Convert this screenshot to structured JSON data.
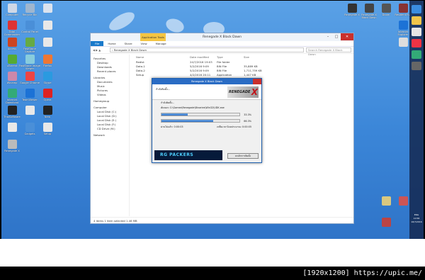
{
  "explorer": {
    "title": "Renegade X Black Dawn",
    "context_tab": "Application Tools",
    "ribbon_tabs": [
      "File",
      "Home",
      "Share",
      "View",
      "Manage"
    ],
    "path": "› Renegade X Black Dawn",
    "search_placeholder": "Search Renegade X Black Dawn",
    "nav": {
      "favorites": "Favorites",
      "fav_items": [
        "Desktop",
        "Downloads",
        "Recent places"
      ],
      "libraries": "Libraries",
      "lib_items": [
        "Documents",
        "Music",
        "Pictures",
        "Videos"
      ],
      "homegroup": "Homegroup",
      "computer": "Computer",
      "comp_items": [
        "Local Disk (C:)",
        "Local Disk (D:)",
        "Local Disk (E:)",
        "Local Disk (F:)",
        "CD Drive (M:)"
      ],
      "network": "Network"
    },
    "columns": [
      "Name",
      "Date modified",
      "Type",
      "Size"
    ],
    "files": [
      {
        "name": "Redist",
        "date": "24/7/2016 19:03",
        "type": "File folder",
        "size": ""
      },
      {
        "name": "Data-1",
        "date": "5/2/2016 9:09",
        "type": "BIN File",
        "size": "35,889 KB"
      },
      {
        "name": "Data-2",
        "date": "5/2/2016 9:09",
        "type": "BIN File",
        "size": "1,711,759 KB"
      },
      {
        "name": "Setup",
        "date": "4/2/2016 20:11",
        "type": "Application",
        "size": "1,447 KB"
      }
    ],
    "status": "4 items    1 item selected 1.46 MB"
  },
  "installer": {
    "title": "Renegade X Black Dawn",
    "header_label": "กำลังติดตั้ง...",
    "logo_text": "RENEGADE",
    "step1": "กำลังติดตั้ง...",
    "file_line": "คัดลอก: C:\\Games\\Renegade\\Binaries\\Win32\\UDK.exe",
    "progress1": {
      "value": 0.333,
      "label": "33.3%"
    },
    "progress2": {
      "value": 0.663,
      "label": "66.3%"
    },
    "elapsed": "ผ่านไปแล้ว: 0:00:03",
    "remaining": "เหลือเวลาโดยประมาณ: 0:00:05",
    "banner": "RG PACKERS",
    "cancel_label": "ยกเลิกการติดตั้ง"
  },
  "desktop_icons_left": [
    {
      "label": "Computer",
      "color": "#cfd8e6"
    },
    {
      "label": "Recycle Bin",
      "color": "#9fb6cf"
    },
    {
      "label": "",
      "color": "#dbe3ee"
    },
    {
      "label": "Total Commander",
      "color": "#d33"
    },
    {
      "label": "Control Panel",
      "color": "#4a8fd8"
    },
    {
      "label": "",
      "color": "#e8e8e8"
    },
    {
      "label": "Access",
      "color": "#c42"
    },
    {
      "label": "FastStone Capture",
      "color": "#6a4"
    },
    {
      "label": "",
      "color": "#e8e8e8"
    },
    {
      "label": "uTorrent",
      "color": "#5a3"
    },
    {
      "label": "FastStone Image Viewer",
      "color": "#8cd"
    },
    {
      "label": "Firefox",
      "color": "#e73"
    },
    {
      "label": "Winamp",
      "color": "#c8a"
    },
    {
      "label": "Google Chrome",
      "color": "#e44"
    },
    {
      "label": "Skype",
      "color": "#2a9ae0"
    },
    {
      "label": "Internet Download Manager",
      "color": "#3a7"
    },
    {
      "label": "TeamViewer",
      "color": "#1c72d6"
    },
    {
      "label": "Opera",
      "color": "#d22"
    },
    {
      "label": "ThaiSoftware",
      "color": "#222"
    },
    {
      "label": "",
      "color": "#e8e8e8"
    },
    {
      "label": "Nero",
      "color": "#222"
    },
    {
      "label": "",
      "color": "#e8e8e8"
    },
    {
      "label": "Gadgets",
      "color": "#4a8fd8"
    },
    {
      "label": "Setup",
      "color": "#e8e8e8"
    },
    {
      "label": "Renegade X",
      "color": "#bbb"
    }
  ],
  "desktop_icons_right": [
    {
      "label": "Renegade X",
      "color": "#333"
    },
    {
      "label": "Renegade X Black Dawn",
      "color": "#444"
    },
    {
      "label": "Doom",
      "color": "#555"
    },
    {
      "label": "Resident Evil",
      "color": "#833"
    },
    {
      "label": "Internet Explorer",
      "color": "#1c72d6"
    },
    {
      "label": "",
      "color": "#ddd"
    },
    {
      "label": "",
      "color": "#d9c880"
    },
    {
      "label": "",
      "color": "#c55"
    },
    {
      "label": "",
      "color": "#b44"
    }
  ],
  "taskbar": {
    "time": "10:58",
    "date": "16/7/2016",
    "lang": "ENG"
  },
  "bottom_bar": {
    "resolution": "[1920x1200]",
    "url": "https://upic.me/"
  }
}
